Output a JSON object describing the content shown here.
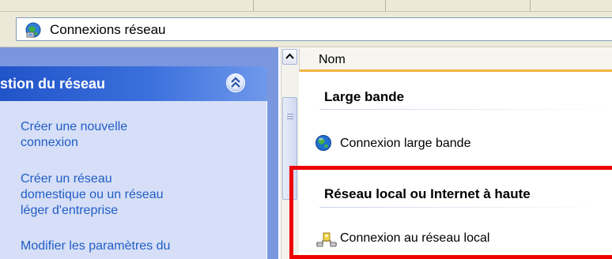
{
  "address_bar": {
    "text": "Connexions réseau",
    "icon": "network-connections-icon"
  },
  "task_pane": {
    "group_title": "stion du réseau",
    "collapse_icon": "double-chevron-up-icon",
    "tasks": [
      {
        "lines": [
          "Créer une nouvelle",
          "connexion"
        ]
      },
      {
        "lines": [
          "Créer un réseau",
          "domestique ou un réseau",
          "léger d'entreprise"
        ]
      },
      {
        "lines": [
          "Modifier les paramètres du"
        ]
      }
    ]
  },
  "content": {
    "column_header": "Nom",
    "groups": [
      {
        "label": "Large bande",
        "items": [
          {
            "label": "Connexion large bande",
            "icon": "globe-icon"
          }
        ]
      },
      {
        "label": "Réseau local ou Internet à haute",
        "items": [
          {
            "label": "Connexion au réseau local",
            "icon": "lan-connection-icon"
          }
        ]
      }
    ]
  },
  "colors": {
    "highlight": "#ee0000",
    "task_link": "#215dc6",
    "header_accent": "#f2b540"
  }
}
